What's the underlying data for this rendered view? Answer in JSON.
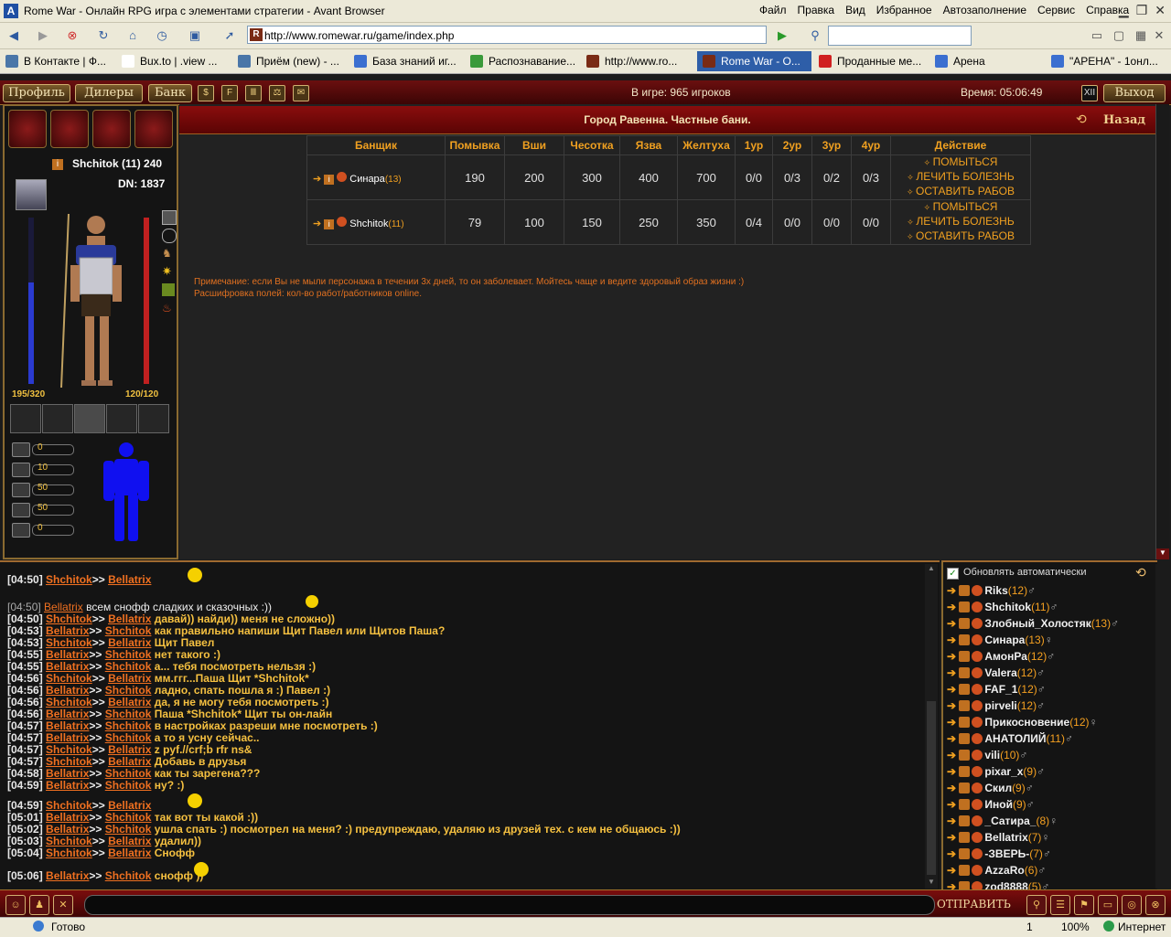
{
  "browser": {
    "title": "Rome War - Онлайн RPG игра с элементами стратегии - Avant Browser",
    "menus": [
      "Файл",
      "Правка",
      "Вид",
      "Избранное",
      "Автозаполнение",
      "Сервис",
      "Справка"
    ],
    "address": "http://www.romewar.ru/game/index.php",
    "tabs": [
      {
        "label": "В Контакте | Ф...",
        "color": "#4a76a8"
      },
      {
        "label": "Bux.to | .view ...",
        "color": "#ffffff"
      },
      {
        "label": "Приём (new) - ...",
        "color": "#4a76a8"
      },
      {
        "label": "База знаний иг...",
        "color": "#3b6fd0"
      },
      {
        "label": "Распознавание...",
        "color": "#3a9a3a"
      },
      {
        "label": "http://www.ro...",
        "color": "#7a2b15"
      },
      {
        "label": "Rome War - O...",
        "color": "#7a2b15"
      },
      {
        "label": "Проданные ме...",
        "color": "#d02020"
      },
      {
        "label": "Арена",
        "color": "#3b6fd0"
      },
      {
        "label": "\"АРЕНА\" - 1онл...",
        "color": "#3b6fd0"
      }
    ],
    "status": "Готово",
    "page_number": "1",
    "zoom": "100%",
    "zone": "Интернет"
  },
  "gamebar": {
    "profile": "Профиль",
    "dealers": "Дилеры",
    "bank": "Банк",
    "online": "В игре: 965 игроков",
    "time": "Время: 05:06:49",
    "exit": "Выход",
    "roman": "XII"
  },
  "character": {
    "name": "Shchitok (11) 240",
    "dn": "DN: 1837",
    "hp": "195/320",
    "mana": "120/120",
    "hp_fill": 0.61,
    "mana_fill": 1.0,
    "stats": [
      "0",
      "10",
      "50",
      "50",
      "0"
    ]
  },
  "page": {
    "title": "Город Равенна. Частные бани.",
    "back": "Назад",
    "headers": [
      "Банщик",
      "Помывка",
      "Вши",
      "Чесотка",
      "Язва",
      "Желтуха",
      "1ур",
      "2ур",
      "3ур",
      "4ур",
      "Действие"
    ],
    "rows": [
      {
        "name": "Синара",
        "level": "(13)",
        "cells": [
          "190",
          "200",
          "300",
          "400",
          "700",
          "0/0",
          "0/3",
          "0/2",
          "0/3"
        ]
      },
      {
        "name": "Shchitok",
        "level": "(11)",
        "cells": [
          "79",
          "100",
          "150",
          "250",
          "350",
          "0/4",
          "0/0",
          "0/0",
          "0/0"
        ]
      }
    ],
    "actions": [
      "ПОМЫТЬСЯ",
      "ЛЕЧИТЬ БОЛЕЗНЬ",
      "ОСТАВИТЬ РАБОВ"
    ],
    "note1": "Примечание: если Вы не мыли персонажа в течении 3х дней, то он заболевает. Мойтесь чаще и ведите здоровый образ жизни :)",
    "note2": "Расшифровка полей: кол-во работ/работников online."
  },
  "chat": [
    {
      "t": "[04:50]",
      "a": "Shchitok",
      "b": "Bellatrix",
      "m": ""
    },
    {
      "t": "[04:50]",
      "a": "Bellatrix",
      "b": "",
      "m": "всем снофф сладких и сказочных :))"
    },
    {
      "t": "[04:50]",
      "a": "Shchitok",
      "b": "Bellatrix",
      "m": "давай)) найди)) меня не сложно))"
    },
    {
      "t": "[04:53]",
      "a": "Bellatrix",
      "b": "Shchitok",
      "m": "как правильно напиши Щит Павел или Щитов Паша?"
    },
    {
      "t": "[04:53]",
      "a": "Shchitok",
      "b": "Bellatrix",
      "m": "Щит Павел"
    },
    {
      "t": "[04:55]",
      "a": "Bellatrix",
      "b": "Shchitok",
      "m": "нет такого :)"
    },
    {
      "t": "[04:55]",
      "a": "Bellatrix",
      "b": "Shchitok",
      "m": "а... тебя посмотреть нельзя :)"
    },
    {
      "t": "[04:56]",
      "a": "Shchitok",
      "b": "Bellatrix",
      "m": "мм.ггг...Паша Щит *Shchitok*"
    },
    {
      "t": "[04:56]",
      "a": "Bellatrix",
      "b": "Shchitok",
      "m": "ладно, спать пошла я :) Павел :)"
    },
    {
      "t": "[04:56]",
      "a": "Shchitok",
      "b": "Bellatrix",
      "m": "да, я не могу тебя посмотреть :)"
    },
    {
      "t": "[04:56]",
      "a": "Bellatrix",
      "b": "Shchitok",
      "m": "Паша *Shchitok* Щит ты он-лайн"
    },
    {
      "t": "[04:57]",
      "a": "Bellatrix",
      "b": "Shchitok",
      "m": "в настройках разреши мне посмотреть :)"
    },
    {
      "t": "[04:57]",
      "a": "Bellatrix",
      "b": "Shchitok",
      "m": "а то я усну сейчас.."
    },
    {
      "t": "[04:57]",
      "a": "Shchitok",
      "b": "Bellatrix",
      "m": "z pyf.//crf;b rfr ns&"
    },
    {
      "t": "[04:57]",
      "a": "Shchitok",
      "b": "Bellatrix",
      "m": "Добавь в друзья"
    },
    {
      "t": "[04:58]",
      "a": "Bellatrix",
      "b": "Shchitok",
      "m": "как ты зарегена???"
    },
    {
      "t": "[04:59]",
      "a": "Bellatrix",
      "b": "Shchitok",
      "m": "ну? :)"
    },
    {
      "t": "[04:59]",
      "a": "Shchitok",
      "b": "Bellatrix",
      "m": ""
    },
    {
      "t": "[05:01]",
      "a": "Bellatrix",
      "b": "Shchitok",
      "m": "так вот ты какой :))"
    },
    {
      "t": "[05:02]",
      "a": "Bellatrix",
      "b": "Shchitok",
      "m": "ушла спать :) посмотрел на меня? :) предупреждаю, удаляю из друзей тех. с кем не  общаюсь :))"
    },
    {
      "t": "[05:03]",
      "a": "Shchitok",
      "b": "Bellatrix",
      "m": "удалил))"
    },
    {
      "t": "[05:04]",
      "a": "Shchitok",
      "b": "Bellatrix",
      "m": "Снофф"
    },
    {
      "t": "[05:06]",
      "a": "Bellatrix",
      "b": "Shchitok",
      "m": "снофф ))"
    }
  ],
  "users": {
    "auto_update": "Обновлять автоматически",
    "list": [
      {
        "n": "Riks",
        "l": "(12)",
        "s": "♂"
      },
      {
        "n": "Shchitok",
        "l": "(11)",
        "s": "♂"
      },
      {
        "n": "Злобный_Холостяк",
        "l": "(13)",
        "s": "♂"
      },
      {
        "n": "Синара",
        "l": "(13)",
        "s": "♀"
      },
      {
        "n": "АмонРа",
        "l": "(12)",
        "s": "♂"
      },
      {
        "n": "Valera",
        "l": "(12)",
        "s": "♂"
      },
      {
        "n": "FAF_1",
        "l": "(12)",
        "s": "♂"
      },
      {
        "n": "pirveli",
        "l": "(12)",
        "s": "♂"
      },
      {
        "n": "Прикосновение",
        "l": "(12)",
        "s": "♀"
      },
      {
        "n": "АНАТОЛИЙ",
        "l": "(11)",
        "s": "♂"
      },
      {
        "n": "vili",
        "l": "(10)",
        "s": "♂"
      },
      {
        "n": "pixar_x",
        "l": "(9)",
        "s": "♂"
      },
      {
        "n": "Скил",
        "l": "(9)",
        "s": "♂"
      },
      {
        "n": "Иной",
        "l": "(9)",
        "s": "♂"
      },
      {
        "n": "_Сатира_",
        "l": "(8)",
        "s": "♀"
      },
      {
        "n": "Bellatrix",
        "l": "(7)",
        "s": "♀"
      },
      {
        "n": "-ЗВЕРЬ-",
        "l": "(7)",
        "s": "♂"
      },
      {
        "n": "AzzaRo",
        "l": "(6)",
        "s": "♂"
      },
      {
        "n": "zod8888",
        "l": "(5)",
        "s": "♂"
      }
    ]
  },
  "input": {
    "send": "ОТПРАВИТЬ"
  }
}
